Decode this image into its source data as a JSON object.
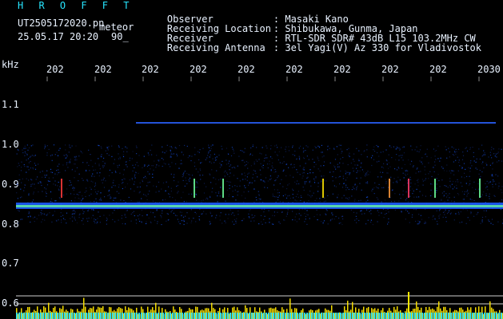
{
  "header": {
    "app_title": "H R O F F T",
    "filename": "UT2505172020.pn",
    "meteor_label": "meteor",
    "datetime": "25.05.17 20:20",
    "count": "90_"
  },
  "station": [
    {
      "label": "Observer",
      "value": ": Masaki Kano"
    },
    {
      "label": "Receiving Location",
      "value": ": Shibukawa, Gunma, Japan"
    },
    {
      "label": "Receiver",
      "value": ": RTL-SDR SDR# 43dB L15 103.2MHz CW"
    },
    {
      "label": "Receiving Antenna",
      "value": ": 3el Yagi(V) Az 330 for Vladivostok"
    }
  ],
  "axes": {
    "y_unit": "kHz",
    "x_ticks": [
      "202",
      "202",
      "202",
      "202",
      "202",
      "202",
      "202",
      "202",
      "202",
      "2030"
    ],
    "y_ticks": [
      "1.1",
      "1.0",
      "0.9",
      "0.8",
      "0.7",
      "0.6"
    ]
  },
  "colors": {
    "background": "#000000",
    "text": "#e9f2ff",
    "title": "#27e6ff",
    "noise": "#1a3cff",
    "carrier": "#6cff9a",
    "histogram": "#ffe600"
  }
}
